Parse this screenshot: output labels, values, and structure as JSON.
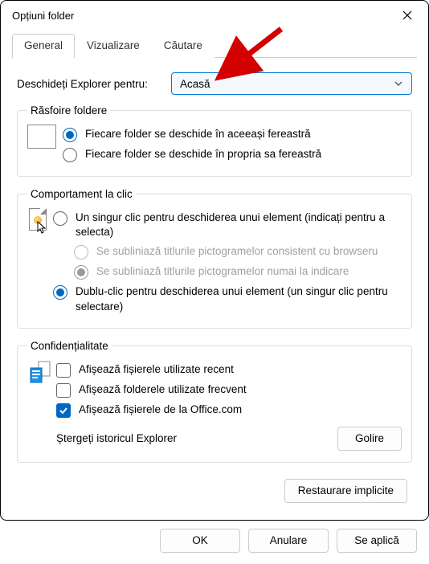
{
  "window": {
    "title": "Opțiuni folder"
  },
  "tabs": {
    "general": "General",
    "view": "Vizualizare",
    "search": "Căutare"
  },
  "open_explorer": {
    "label": "Deschideți Explorer pentru:",
    "value": "Acasă"
  },
  "browse": {
    "legend": "Răsfoire foldere",
    "same_window": "Fiecare folder se deschide în aceeași fereastră",
    "own_window": "Fiecare folder se deschide în propria sa fereastră"
  },
  "click": {
    "legend": "Comportament la clic",
    "single": "Un singur clic pentru deschiderea unui element (indicați pentru a selecta)",
    "underline_browser": "Se subliniază titlurile pictogramelor consistent cu browseru",
    "underline_point": "Se subliniază titlurile pictogramelor numai la indicare",
    "double": "Dublu-clic pentru deschiderea unui element (un singur clic pentru selectare)"
  },
  "privacy": {
    "legend": "Confidențialitate",
    "recent_files": "Afișează fișierele utilizate recent",
    "frequent_folders": "Afișează folderele utilizate frecvent",
    "office_files": "Afișează fișierele de la Office.com",
    "clear_label": "Ștergeți istoricul Explorer",
    "clear_btn": "Golire"
  },
  "buttons": {
    "restore": "Restaurare implicite",
    "ok": "OK",
    "cancel": "Anulare",
    "apply": "Se aplică"
  }
}
